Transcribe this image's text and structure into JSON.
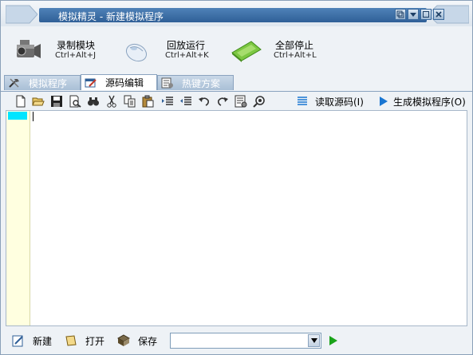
{
  "window": {
    "title": "模拟精灵 - 新建模拟程序",
    "controls": [
      "restore",
      "dropdown",
      "maximize",
      "close"
    ]
  },
  "actions": [
    {
      "label": "录制模块",
      "shortcut": "Ctrl+Alt+J",
      "icon": "camcorder-icon"
    },
    {
      "label": "回放运行",
      "shortcut": "Ctrl+Alt+K",
      "icon": "mouse-icon"
    },
    {
      "label": "全部停止",
      "shortcut": "Ctrl+Alt+L",
      "icon": "stop-icon"
    }
  ],
  "tabs": [
    {
      "label": "模拟程序",
      "icon": "tools-icon",
      "active": false
    },
    {
      "label": "源码编辑",
      "icon": "edit-icon",
      "active": true
    },
    {
      "label": "热键方案",
      "icon": "hotkey-icon",
      "active": false
    }
  ],
  "toolbar": {
    "icons": [
      "new-file-icon",
      "open-folder-icon",
      "save-icon",
      "print-preview-icon",
      "find-icon",
      "cut-icon",
      "copy-icon",
      "paste-icon",
      "indent-icon",
      "outdent-icon",
      "undo-icon",
      "redo-icon",
      "properties-icon",
      "settings-icon"
    ],
    "read_source_label": "读取源码(I)",
    "generate_label": "生成模拟程序(O)"
  },
  "editor": {
    "content": "",
    "line_marker_color": "#00e5ff",
    "gutter_color": "#ffffe0"
  },
  "bottombar": {
    "new_label": "新建",
    "open_label": "打开",
    "save_label": "保存",
    "combo_value": ""
  },
  "colors": {
    "accent": "#2f5f97",
    "window_bg": "#eef2f6",
    "run_green": "#1aa31a",
    "link_blue": "#1976d2"
  }
}
